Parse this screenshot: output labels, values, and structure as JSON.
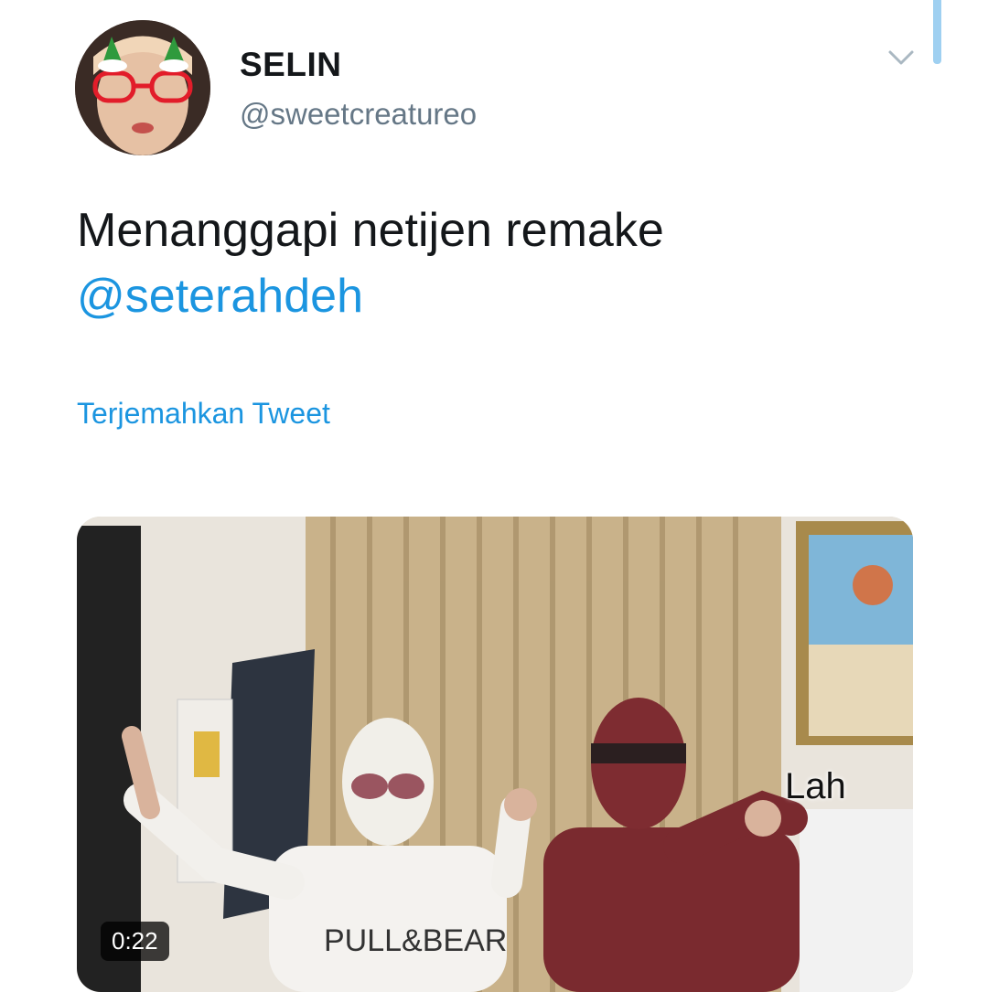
{
  "tweet": {
    "author": {
      "display_name": "SELIN",
      "handle": "@sweetcreatureo"
    },
    "text": "Menanggapi netijen remake",
    "mention": "@seterahdeh",
    "translate_label": "Terjemahkan Tweet",
    "media": {
      "duration": "0:22",
      "caption_overlay": "Lah",
      "shirt_text": "PULL&BEAR"
    }
  },
  "icons": {
    "menu": "chevron-down-icon"
  },
  "colors": {
    "link": "#1b95e0",
    "text_primary": "#14171a",
    "text_secondary": "#657786",
    "scroll_indicator": "#9fd0f1"
  }
}
